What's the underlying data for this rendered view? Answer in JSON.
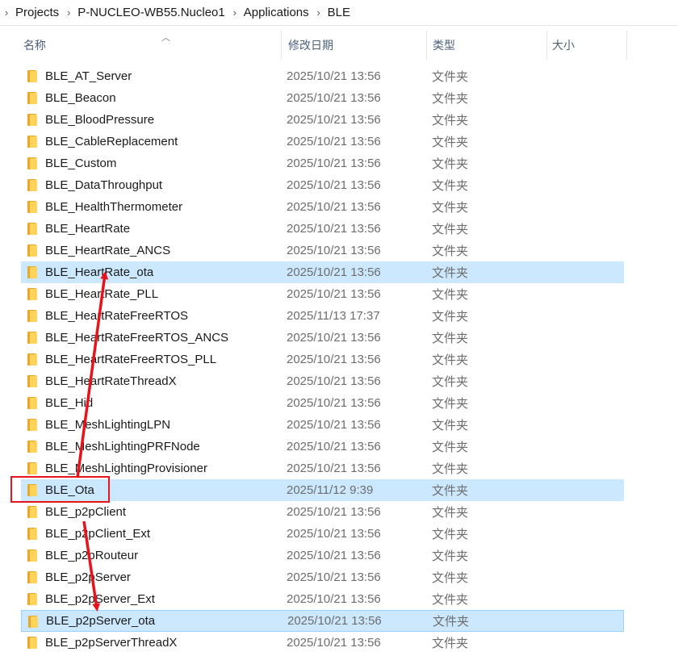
{
  "breadcrumb": [
    "Projects",
    "P-NUCLEO-WB55.Nucleo1",
    "Applications",
    "BLE"
  ],
  "columns": {
    "name": "名称",
    "date": "修改日期",
    "type": "类型",
    "size": "大小"
  },
  "sort": {
    "column": "name",
    "direction": "ascending"
  },
  "files": [
    {
      "name": "BLE_AT_Server",
      "date": "2025/10/21 13:56",
      "type": "文件夹"
    },
    {
      "name": "BLE_Beacon",
      "date": "2025/10/21 13:56",
      "type": "文件夹"
    },
    {
      "name": "BLE_BloodPressure",
      "date": "2025/10/21 13:56",
      "type": "文件夹"
    },
    {
      "name": "BLE_CableReplacement",
      "date": "2025/10/21 13:56",
      "type": "文件夹"
    },
    {
      "name": "BLE_Custom",
      "date": "2025/10/21 13:56",
      "type": "文件夹"
    },
    {
      "name": "BLE_DataThroughput",
      "date": "2025/10/21 13:56",
      "type": "文件夹"
    },
    {
      "name": "BLE_HealthThermometer",
      "date": "2025/10/21 13:56",
      "type": "文件夹"
    },
    {
      "name": "BLE_HeartRate",
      "date": "2025/10/21 13:56",
      "type": "文件夹"
    },
    {
      "name": "BLE_HeartRate_ANCS",
      "date": "2025/10/21 13:56",
      "type": "文件夹"
    },
    {
      "name": "BLE_HeartRate_ota",
      "date": "2025/10/21 13:56",
      "type": "文件夹",
      "selected": true
    },
    {
      "name": "BLE_HeartRate_PLL",
      "date": "2025/10/21 13:56",
      "type": "文件夹"
    },
    {
      "name": "BLE_HeartRateFreeRTOS",
      "date": "2025/11/13 17:37",
      "type": "文件夹"
    },
    {
      "name": "BLE_HeartRateFreeRTOS_ANCS",
      "date": "2025/10/21 13:56",
      "type": "文件夹"
    },
    {
      "name": "BLE_HeartRateFreeRTOS_PLL",
      "date": "2025/10/21 13:56",
      "type": "文件夹"
    },
    {
      "name": "BLE_HeartRateThreadX",
      "date": "2025/10/21 13:56",
      "type": "文件夹"
    },
    {
      "name": "BLE_Hid",
      "date": "2025/10/21 13:56",
      "type": "文件夹"
    },
    {
      "name": "BLE_MeshLightingLPN",
      "date": "2025/10/21 13:56",
      "type": "文件夹"
    },
    {
      "name": "BLE_MeshLightingPRFNode",
      "date": "2025/10/21 13:56",
      "type": "文件夹"
    },
    {
      "name": "BLE_MeshLightingProvisioner",
      "date": "2025/10/21 13:56",
      "type": "文件夹"
    },
    {
      "name": "BLE_Ota",
      "date": "2025/11/12 9:39",
      "type": "文件夹",
      "selected": true
    },
    {
      "name": "BLE_p2pClient",
      "date": "2025/10/21 13:56",
      "type": "文件夹"
    },
    {
      "name": "BLE_p2pClient_Ext",
      "date": "2025/10/21 13:56",
      "type": "文件夹"
    },
    {
      "name": "BLE_p2pRouteur",
      "date": "2025/10/21 13:56",
      "type": "文件夹"
    },
    {
      "name": "BLE_p2pServer",
      "date": "2025/10/21 13:56",
      "type": "文件夹"
    },
    {
      "name": "BLE_p2pServer_Ext",
      "date": "2025/10/21 13:56",
      "type": "文件夹"
    },
    {
      "name": "BLE_p2pServer_ota",
      "date": "2025/10/21 13:56",
      "type": "文件夹",
      "selected": true,
      "outlined": true
    },
    {
      "name": "BLE_p2pServerThreadX",
      "date": "2025/10/21 13:56",
      "type": "文件夹"
    }
  ],
  "colors": {
    "selection": "#cce8ff",
    "selection_border": "#99d1ff",
    "annotation": "#e8141c",
    "folder": "#ffd35c"
  },
  "icons": {
    "breadcrumb_separator": "chevron-right-icon",
    "sort_indicator": "chevron-up-icon",
    "file_icon": "folder-icon"
  }
}
